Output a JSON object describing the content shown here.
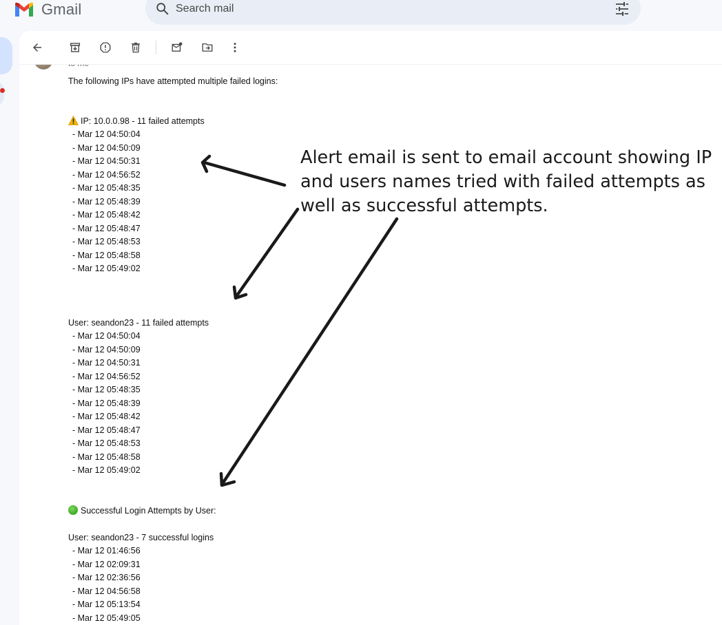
{
  "app": {
    "name": "Gmail"
  },
  "search": {
    "placeholder": "Search mail"
  },
  "email": {
    "recipient_line": "to me",
    "intro": "The following IPs have attempted multiple failed logins:",
    "ip_section": {
      "heading": "IP: 10.0.0.98 - 11 failed attempts",
      "entries": [
        "- Mar 12 04:50:04",
        "- Mar 12 04:50:09",
        "- Mar 12 04:50:31",
        "- Mar 12 04:56:52",
        "- Mar 12 05:48:35",
        "- Mar 12 05:48:39",
        "- Mar 12 05:48:42",
        "- Mar 12 05:48:47",
        "- Mar 12 05:48:53",
        "- Mar 12 05:48:58",
        "- Mar 12 05:49:02"
      ]
    },
    "user_section": {
      "heading": "User: seandon23 - 11 failed attempts",
      "entries": [
        "- Mar 12 04:50:04",
        "- Mar 12 04:50:09",
        "- Mar 12 04:50:31",
        "- Mar 12 04:56:52",
        "- Mar 12 05:48:35",
        "- Mar 12 05:48:39",
        "- Mar 12 05:48:42",
        "- Mar 12 05:48:47",
        "- Mar 12 05:48:53",
        "- Mar 12 05:48:58",
        "- Mar 12 05:49:02"
      ]
    },
    "success_section": {
      "title": "Successful Login Attempts by User:",
      "heading": "User: seandon23 - 7 successful logins",
      "entries": [
        "- Mar 12 01:46:56",
        "- Mar 12 02:09:31",
        "- Mar 12 02:36:56",
        "- Mar 12 04:56:58",
        "- Mar 12 05:13:54",
        "- Mar 12 05:49:05"
      ]
    }
  },
  "annotation": {
    "lines": [
      "Alert email is sent to email account showing IP",
      "and users names tried with failed attempts as",
      "well as successful attempts."
    ]
  },
  "icons": {
    "back": "arrow-back-icon",
    "archive": "archive-icon",
    "spam": "report-spam-icon",
    "delete": "delete-icon",
    "mark_unread": "mark-unread-icon",
    "move": "move-to-icon",
    "more": "more-vert-icon",
    "search": "search-icon",
    "tune": "tune-icon"
  },
  "colors": {
    "background": "#f6f8fc",
    "search_bg": "#e9eef6",
    "nav_active": "#d3e3fd",
    "unread_dot": "#d93025"
  }
}
